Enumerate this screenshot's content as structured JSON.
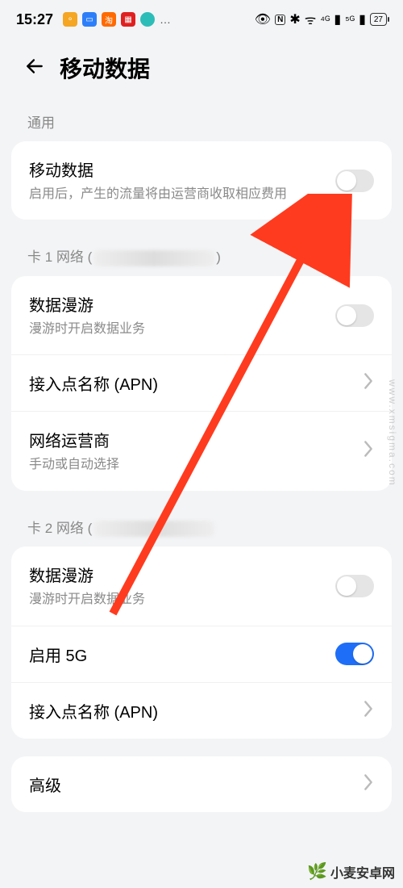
{
  "status": {
    "time": "15:27",
    "dots": "…",
    "nfc": "N",
    "bt": "✱",
    "wifi": "ᯤ",
    "sig1": "⁴ᴳ",
    "sig2": "⁵ᴳ",
    "battery": "27"
  },
  "header": {
    "title": "移动数据"
  },
  "sections": {
    "general_label": "通用",
    "mobile_data": {
      "title": "移动数据",
      "sub": "启用后，产生的流量将由运营商收取相应费用",
      "on": false
    },
    "sim1_label_prefix": "卡 1 网络 (",
    "sim1_label_suffix": ")",
    "sim1": {
      "roaming_title": "数据漫游",
      "roaming_sub": "漫游时开启数据业务",
      "roaming_on": false,
      "apn_title": "接入点名称 (APN)",
      "carrier_title": "网络运营商",
      "carrier_sub": "手动或自动选择"
    },
    "sim2_label_prefix": "卡 2 网络 (",
    "sim2_label_suffix": "",
    "sim2": {
      "roaming_title": "数据漫游",
      "roaming_sub": "漫游时开启数据业务",
      "roaming_on": false,
      "fiveg_title": "启用 5G",
      "fiveg_on": true,
      "apn_title": "接入点名称 (APN)"
    },
    "advanced": "高级"
  },
  "watermarks": {
    "side": "www.xmsigma.com",
    "brand": "小麦安卓网"
  }
}
